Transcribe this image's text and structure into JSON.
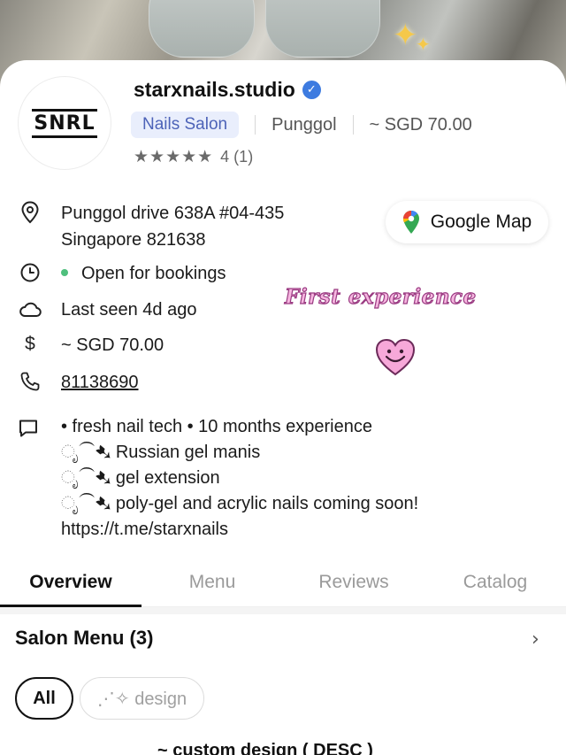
{
  "shop": {
    "name": "starxnails.studio",
    "logo_text": "SNRL",
    "category": "Nails Salon",
    "area": "Punggol",
    "price": "~ SGD 70.00",
    "stars": "★★★★★",
    "rating": "4 (1)"
  },
  "info": {
    "address_line1": "Punggol drive 638A #04-435",
    "address_line2": "Singapore 821638",
    "status": "Open for bookings",
    "last_seen": "Last seen 4d ago",
    "price": "~ SGD 70.00",
    "phone": "81138690",
    "map_button": "Google Map"
  },
  "sticker": {
    "text": "First  experience"
  },
  "bio": {
    "lines": [
      "• fresh nail tech • 10 months experience",
      "ೃ⁀➷ Russian gel manis",
      "ೃ⁀➷  gel extension",
      "ೃ⁀➷ poly-gel and acrylic nails coming soon!",
      "https://t.me/starxnails"
    ]
  },
  "tabs": [
    "Overview",
    "Menu",
    "Reviews",
    "Catalog"
  ],
  "menu": {
    "title": "Salon Menu (3)",
    "chevron": "›",
    "chips": [
      "All",
      "⋰✧ design"
    ],
    "first_item": "~ custom design ( DESC )"
  },
  "colors": {
    "accent": "#4d63b8",
    "verified": "#3d7be0",
    "open_status": "#4fbf7d"
  }
}
